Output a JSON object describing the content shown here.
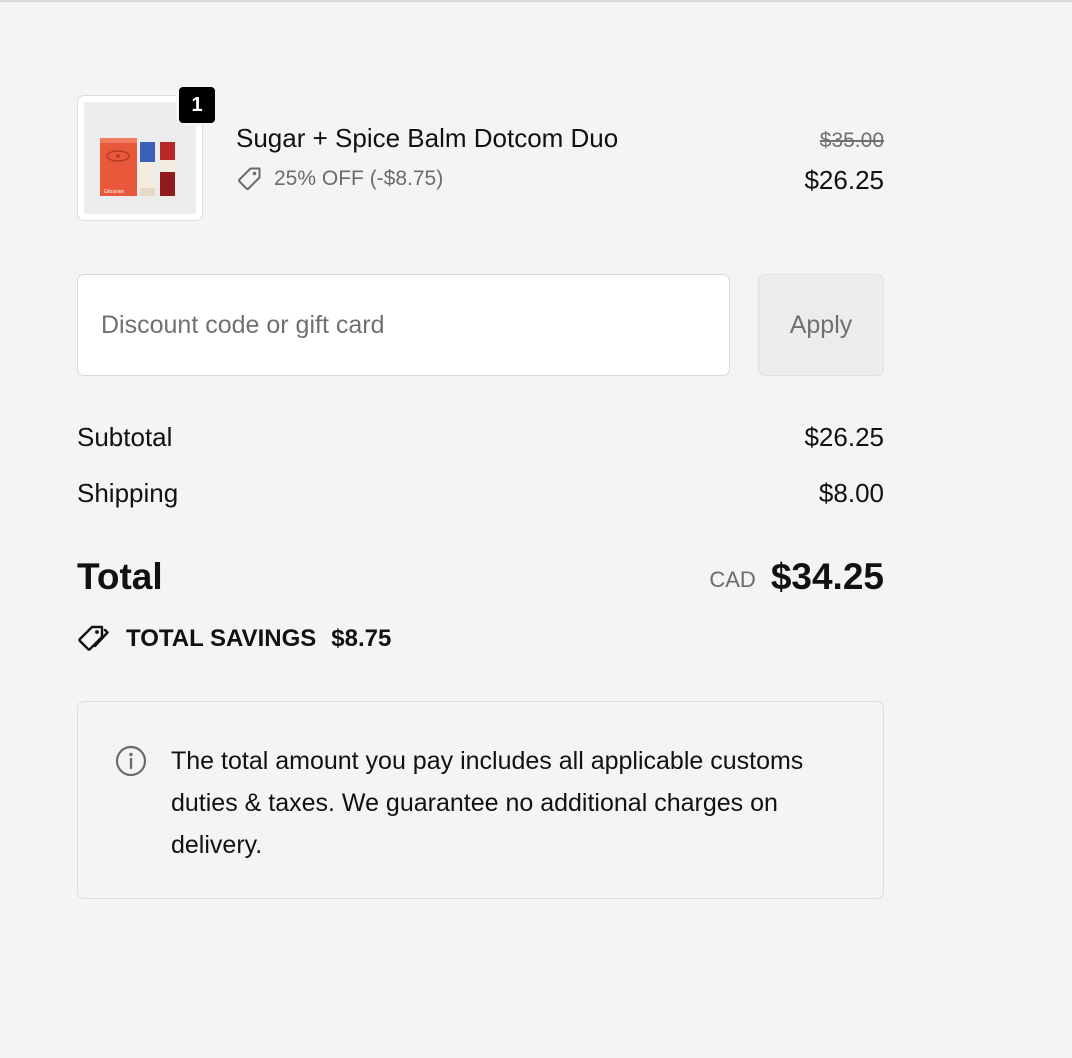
{
  "product": {
    "name": "Sugar + Spice Balm Dotcom Duo",
    "quantity": "1",
    "discount_text": "25% OFF (-$8.75)",
    "price_original": "$35.00",
    "price_final": "$26.25",
    "image_brand_text": "Glossier."
  },
  "discount": {
    "placeholder": "Discount code or gift card",
    "value": "",
    "apply_label": "Apply"
  },
  "costs": {
    "subtotal_label": "Subtotal",
    "subtotal_value": "$26.25",
    "shipping_label": "Shipping",
    "shipping_value": "$8.00",
    "total_label": "Total",
    "currency": "CAD",
    "total_value": "$34.25"
  },
  "savings": {
    "label": "TOTAL SAVINGS",
    "amount": "$8.75"
  },
  "notice": {
    "text": "The total amount you pay includes all applicable customs duties & taxes. We guarantee no additional charges on delivery."
  },
  "colors": {
    "background": "#f4f4f4",
    "text": "#111111",
    "muted": "#707070",
    "badge": "#000000",
    "product_box": "#e8583a",
    "product_blue": "#3b5fb8",
    "product_red": "#b8282a"
  },
  "icons": {
    "discount_tag": "tag-icon",
    "savings_tags": "tags-icon",
    "info": "info-circle-icon"
  }
}
